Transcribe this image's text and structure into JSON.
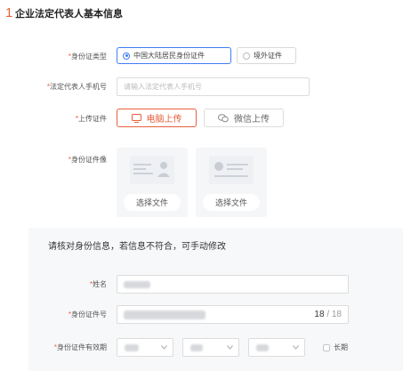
{
  "section": {
    "number": "1",
    "title": "企业法定代表人基本信息"
  },
  "id_type": {
    "required_mark": "*",
    "label": "身份证类型",
    "options": [
      {
        "label": "中国大陆居民身份证件",
        "selected": true
      },
      {
        "label": "境外证件",
        "selected": false
      }
    ]
  },
  "phone": {
    "required_mark": "*",
    "label": "法定代表人手机号",
    "placeholder": "请输入法定代表人手机号"
  },
  "upload": {
    "required_mark": "*",
    "label": "上传证件",
    "options": [
      {
        "label": "电脑上传",
        "icon": "monitor-icon",
        "selected": true
      },
      {
        "label": "微信上传",
        "icon": "wechat-icon",
        "selected": false
      }
    ]
  },
  "id_image": {
    "required_mark": "*",
    "label": "身份证件像",
    "cards": [
      {
        "button": "选择文件",
        "icon": "id-card-front-icon"
      },
      {
        "button": "选择文件",
        "icon": "id-card-back-icon"
      }
    ]
  },
  "verify": {
    "title": "请核对身份信息，若信息不符合，可手动修改",
    "name": {
      "required_mark": "*",
      "label": "姓名"
    },
    "id_number": {
      "required_mark": "*",
      "label": "身份证件号",
      "count": "18",
      "max": "/ 18"
    },
    "validity": {
      "required_mark": "*",
      "label": "身份证件有效期",
      "long_term": "长期"
    }
  },
  "colors": {
    "accent": "#e7603c",
    "selected": "#3f7ef5"
  }
}
